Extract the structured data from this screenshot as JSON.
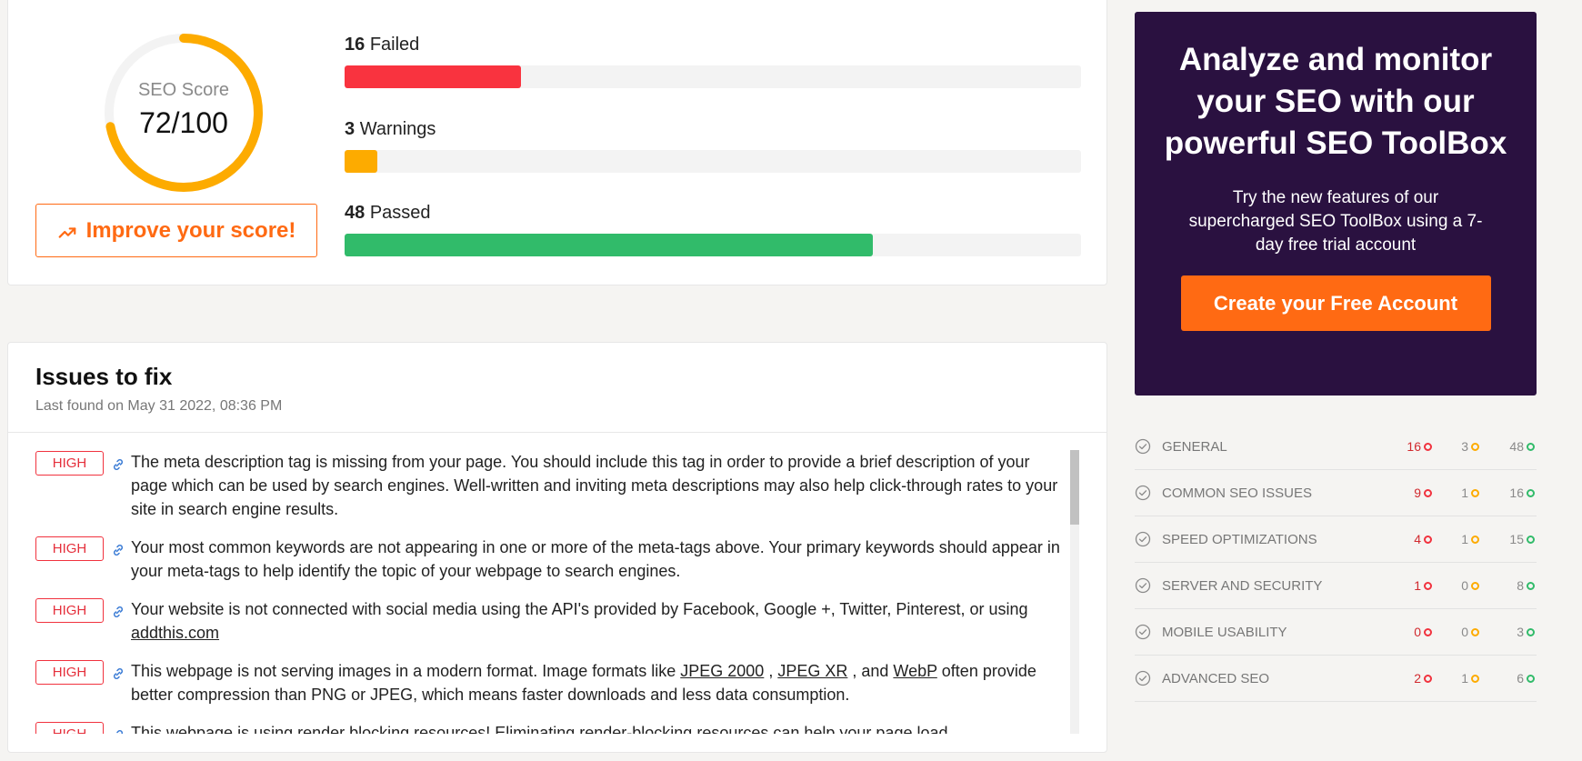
{
  "score": {
    "label": "SEO Score",
    "value": "72/100",
    "fraction": 0.72,
    "improve_label": "Improve your score!"
  },
  "stats": [
    {
      "count": "16",
      "label": "Failed",
      "fill_fraction": 0.24,
      "color": "#f9333f"
    },
    {
      "count": "3",
      "label": "Warnings",
      "fill_fraction": 0.045,
      "color": "#fdab00"
    },
    {
      "count": "48",
      "label": "Passed",
      "fill_fraction": 0.717,
      "color": "#31bb6a"
    }
  ],
  "issues": {
    "title": "Issues to fix",
    "subtitle": "Last found on May 31 2022, 08:36 PM",
    "items": [
      {
        "severity": "HIGH",
        "text": "The meta description tag is missing from your page. You should include this tag in order to provide a brief description of your page which can be used by search engines. Well-written and inviting meta descriptions may also help click-through rates to your site in search engine results."
      },
      {
        "severity": "HIGH",
        "text": "Your most common keywords are not appearing in one or more of the meta-tags above. Your primary keywords should appear in your meta-tags to help identify the topic of your webpage to search engines."
      },
      {
        "severity": "HIGH",
        "text_before": "Your website is not connected with social media using the API's provided by Facebook, Google +, Twitter, Pinterest, or using ",
        "link": "addthis.com"
      },
      {
        "severity": "HIGH",
        "text_a": "This webpage is not serving images in a modern format. Image formats like ",
        "link_1": "JPEG 2000",
        "sep_1": " , ",
        "link_2": "JPEG XR",
        "sep_2": " , and ",
        "link_3": "WebP",
        "text_b": "  often provide better compression than PNG or JPEG, which means faster downloads and less data consumption."
      },
      {
        "severity": "HIGH",
        "text": "This webpage is using render blocking resources! Eliminating render-blocking resources can help your page load"
      }
    ]
  },
  "promo": {
    "title": "Analyze and monitor your SEO with our powerful SEO ToolBox",
    "text": "Try the new features of our supercharged SEO ToolBox using a 7-day free trial account",
    "button": "Create your Free Account"
  },
  "categories": [
    {
      "label": "General",
      "failed": "16",
      "warnings": "3",
      "passed": "48"
    },
    {
      "label": "Common SEO Issues",
      "failed": "9",
      "warnings": "1",
      "passed": "16"
    },
    {
      "label": "Speed Optimizations",
      "failed": "4",
      "warnings": "1",
      "passed": "15"
    },
    {
      "label": "Server and Security",
      "failed": "1",
      "warnings": "0",
      "passed": "8"
    },
    {
      "label": "Mobile Usability",
      "failed": "0",
      "warnings": "0",
      "passed": "3"
    },
    {
      "label": "Advanced SEO",
      "failed": "2",
      "warnings": "1",
      "passed": "6"
    }
  ],
  "colors": {
    "accent": "#ff6a13",
    "failed": "#f9333f",
    "warning": "#fdab00",
    "passed": "#31bb6a",
    "promo_bg": "#2a1140"
  }
}
